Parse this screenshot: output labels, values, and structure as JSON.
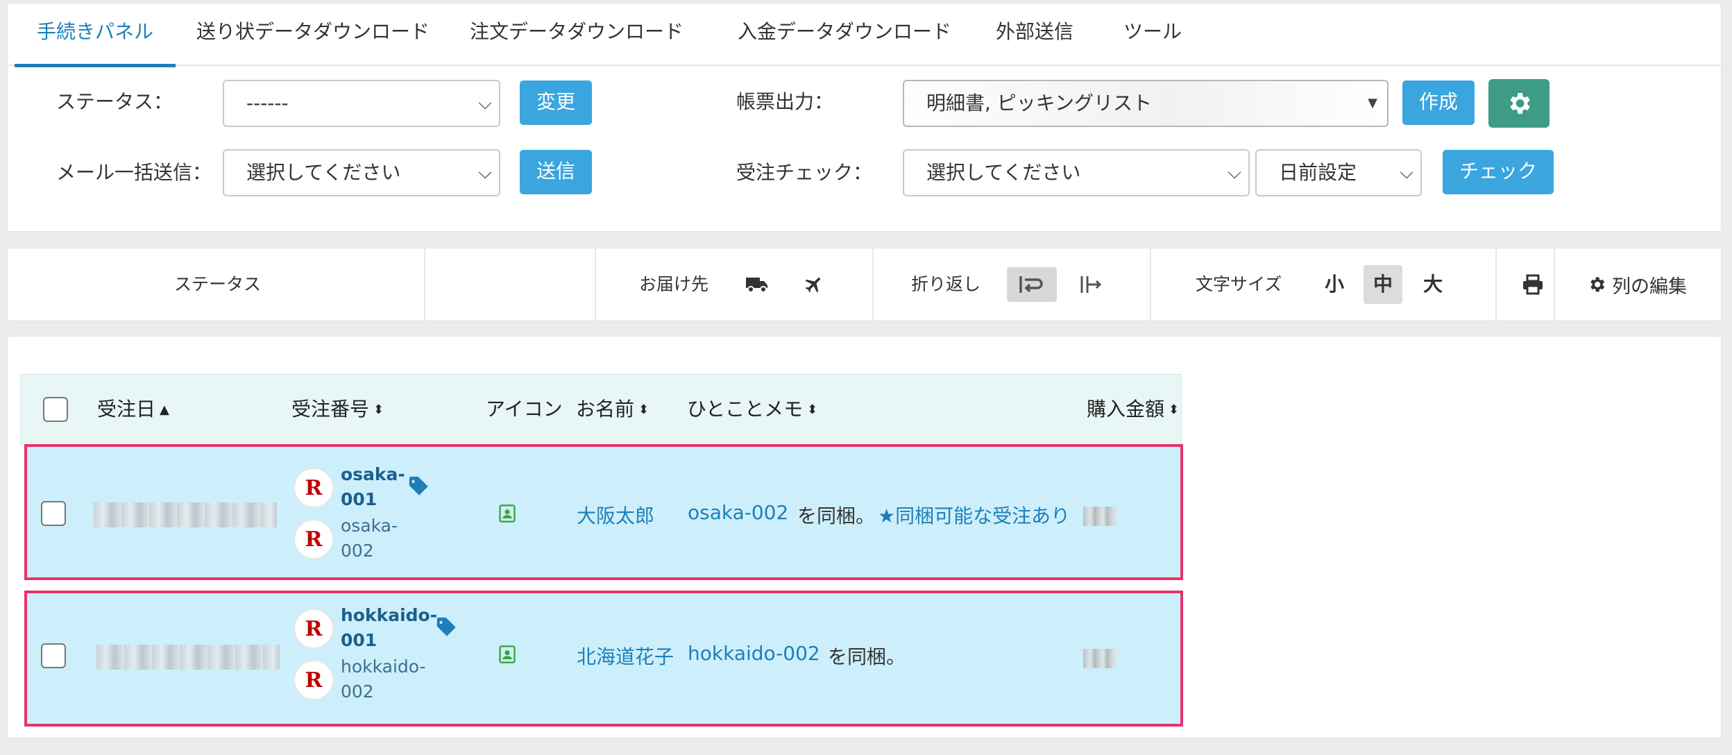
{
  "tabs": [
    {
      "label": "手続きパネル",
      "active": true
    },
    {
      "label": "送り状データダウンロード"
    },
    {
      "label": "注文データダウンロード"
    },
    {
      "label": "入金データダウンロード"
    },
    {
      "label": "外部送信"
    },
    {
      "label": "ツール"
    }
  ],
  "controls": {
    "status_label": "ステータス：",
    "status_value": "------",
    "change_button": "変更",
    "mail_label": "メール一括送信：",
    "mail_value": "選択してください",
    "send_button": "送信",
    "forms_label": "帳票出力：",
    "forms_value": "明細書, ピッキングリスト",
    "create_button": "作成",
    "check_label": "受注チェック：",
    "check_value": "選択してください",
    "days_value": "日前設定",
    "check_button": "チェック"
  },
  "toolbar": {
    "status": "ステータス",
    "delivery": "お届け先",
    "wrap": "折り返し",
    "font_size": "文字サイズ",
    "size_small": "小",
    "size_medium": "中",
    "size_large": "大",
    "edit_columns": "列の編集"
  },
  "table": {
    "headers": {
      "order_date": "受注日",
      "order_number": "受注番号",
      "icon": "アイコン",
      "name": "お名前",
      "memo": "ひとことメモ",
      "amount": "購入金額"
    },
    "rows": [
      {
        "order_no_line1": "osaka-",
        "order_no_line2": "001",
        "sub_no_line1": "osaka-",
        "sub_no_line2": "002",
        "name": "大阪太郎",
        "memo_link": "osaka-002",
        "memo_text": "を同梱。",
        "memo_extra": "★同梱可能な受注あり"
      },
      {
        "order_no_line1": "hokkaido-",
        "order_no_line2": "001",
        "sub_no_line1": "hokkaido-",
        "sub_no_line2": "002",
        "name": "北海道花子",
        "memo_link": "hokkaido-002",
        "memo_text": "を同梱。"
      }
    ]
  },
  "colors": {
    "primary_blue": "#3aa5df",
    "tab_active": "#1e7fb8",
    "gear_green": "#3d9b86",
    "row_highlight": "#cdeffb",
    "row_border": "#e8326b"
  }
}
